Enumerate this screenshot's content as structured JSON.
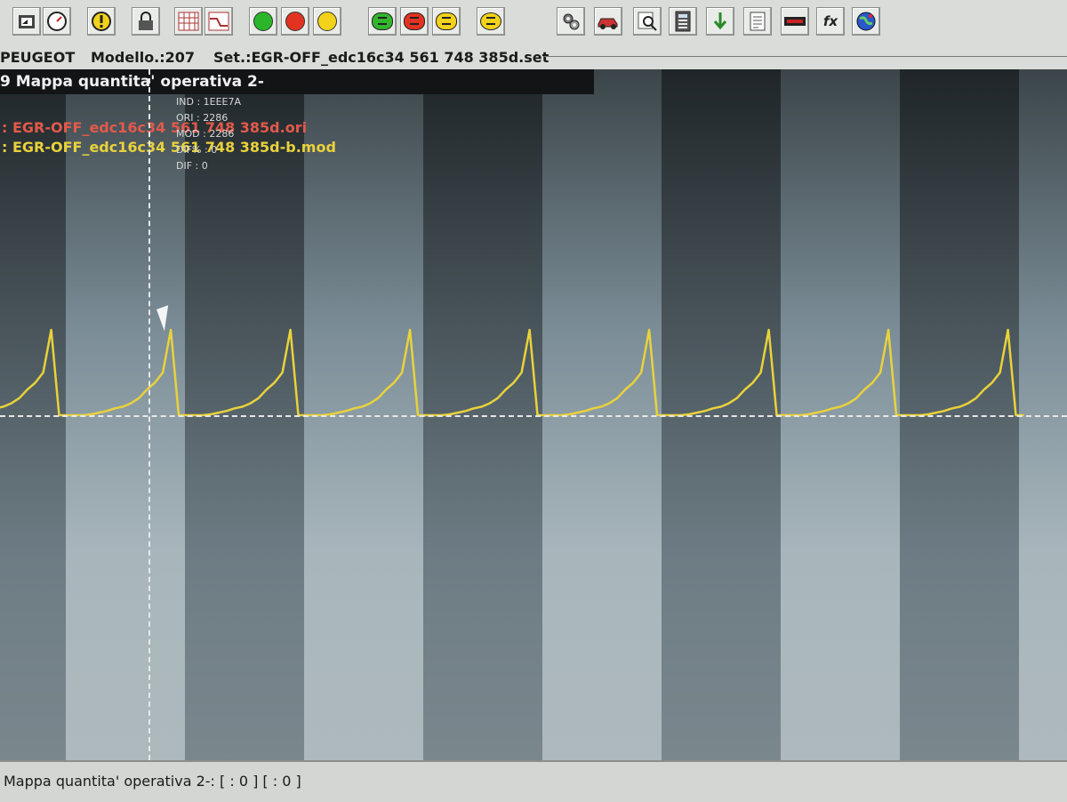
{
  "toolbar": {
    "buttons": [
      {
        "icon": "open-folder-icon"
      },
      {
        "icon": "gauge-icon"
      },
      {
        "icon": "warning-icon"
      },
      {
        "icon": "lock-icon"
      },
      {
        "icon": "grid-view-icon"
      },
      {
        "icon": "graph-view-icon"
      },
      {
        "icon": "green-dot-icon",
        "color": "#2bb52b"
      },
      {
        "icon": "red-dot-icon",
        "color": "#e23322"
      },
      {
        "icon": "yellow-dot-icon",
        "color": "#f2d21a"
      },
      {
        "icon": "green-pad-icon",
        "color": "#33b52e"
      },
      {
        "icon": "red-pad-icon",
        "color": "#e23322"
      },
      {
        "icon": "yellow-pad-icon",
        "color": "#f2d21a"
      },
      {
        "icon": "yellow-pad-alt-icon",
        "color": "#f2d21a"
      },
      {
        "icon": "settings-gears-icon"
      },
      {
        "icon": "car-icon"
      },
      {
        "icon": "zoom-icon"
      },
      {
        "icon": "calculator-icon"
      },
      {
        "icon": "down-arrow-icon"
      },
      {
        "icon": "document-icon"
      },
      {
        "icon": "battery-icon"
      },
      {
        "icon": "function-icon",
        "glyph": "fx"
      },
      {
        "icon": "globe-icon"
      }
    ]
  },
  "infobar": {
    "brand": "PEUGEOT",
    "model": "Modello.:207",
    "set": "Set.:EGR-OFF_edc16c34 561 748 385d.set"
  },
  "graph": {
    "map_title": "9 Mappa quantita' operativa 2-",
    "file_ori": ": EGR-OFF_edc16c34 561 748 385d.ori",
    "file_mod": ": EGR-OFF_edc16c34 561 748 385d-b.mod",
    "readout": {
      "ind": "IND : 1EEE7A",
      "ori": "ORI : 2286",
      "mod": "MOD : 2286",
      "dif_pct": "DIF% : 0",
      "dif": "DIF : 0"
    },
    "colors": {
      "ori": "#e25a4b",
      "mod": "#e9d23b"
    }
  },
  "chart_data": {
    "type": "line",
    "series": [
      {
        "color": "#e9d23b",
        "values": [
          0,
          0,
          0,
          1,
          3,
          5,
          8,
          10,
          14,
          20,
          30,
          38,
          50,
          100,
          0,
          0,
          0,
          0,
          1,
          3,
          5,
          8,
          10,
          14,
          20,
          30,
          38,
          50,
          100,
          0,
          0,
          0,
          0,
          1,
          3,
          5,
          8,
          10,
          14,
          20,
          30,
          38,
          50,
          100,
          0,
          0,
          0,
          0,
          1,
          3,
          5,
          8,
          10,
          14,
          20,
          30,
          38,
          50,
          100,
          0,
          0,
          0,
          0,
          1,
          3,
          5,
          8,
          10,
          14,
          20,
          30,
          38,
          50,
          100,
          0,
          0,
          0,
          0,
          1,
          3,
          5,
          8,
          10,
          14,
          20,
          30,
          38,
          50,
          100,
          0,
          0,
          0,
          0,
          1,
          3,
          5,
          8,
          10,
          14,
          20,
          30,
          38,
          50,
          100,
          0,
          0,
          0,
          0,
          1,
          3,
          5,
          8,
          10,
          14,
          20,
          30,
          38,
          50,
          100,
          0,
          0,
          0,
          0,
          1,
          3,
          5,
          8,
          10,
          14,
          20,
          30,
          38,
          50,
          100,
          0,
          0
        ]
      }
    ],
    "grid": false
  },
  "statusbar": {
    "text": "Mappa quantita' operativa 2-: [ : 0 ] [ : 0 ]"
  }
}
